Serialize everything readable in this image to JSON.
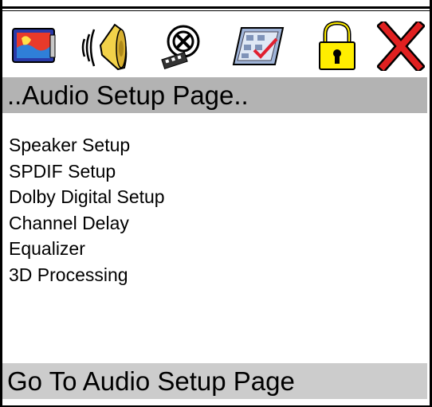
{
  "toolbar": {
    "icons": [
      "general-setup-icon",
      "audio-speaker-icon",
      "video-film-icon",
      "preferences-checklist-icon",
      "password-lock-icon",
      "exit-x-icon"
    ]
  },
  "page": {
    "title": "..Audio Setup Page.."
  },
  "menu": {
    "items": [
      {
        "label": "Speaker Setup"
      },
      {
        "label": "SPDIF Setup"
      },
      {
        "label": "Dolby Digital Setup"
      },
      {
        "label": "Channel Delay"
      },
      {
        "label": "Equalizer"
      },
      {
        "label": "3D Processing"
      }
    ]
  },
  "status": {
    "text": "Go To Audio Setup Page"
  },
  "colors": {
    "title_bg": "#b3b3b3",
    "status_bg": "#cccccc",
    "lock_yellow": "#ffee00",
    "exit_red": "#e02020"
  }
}
